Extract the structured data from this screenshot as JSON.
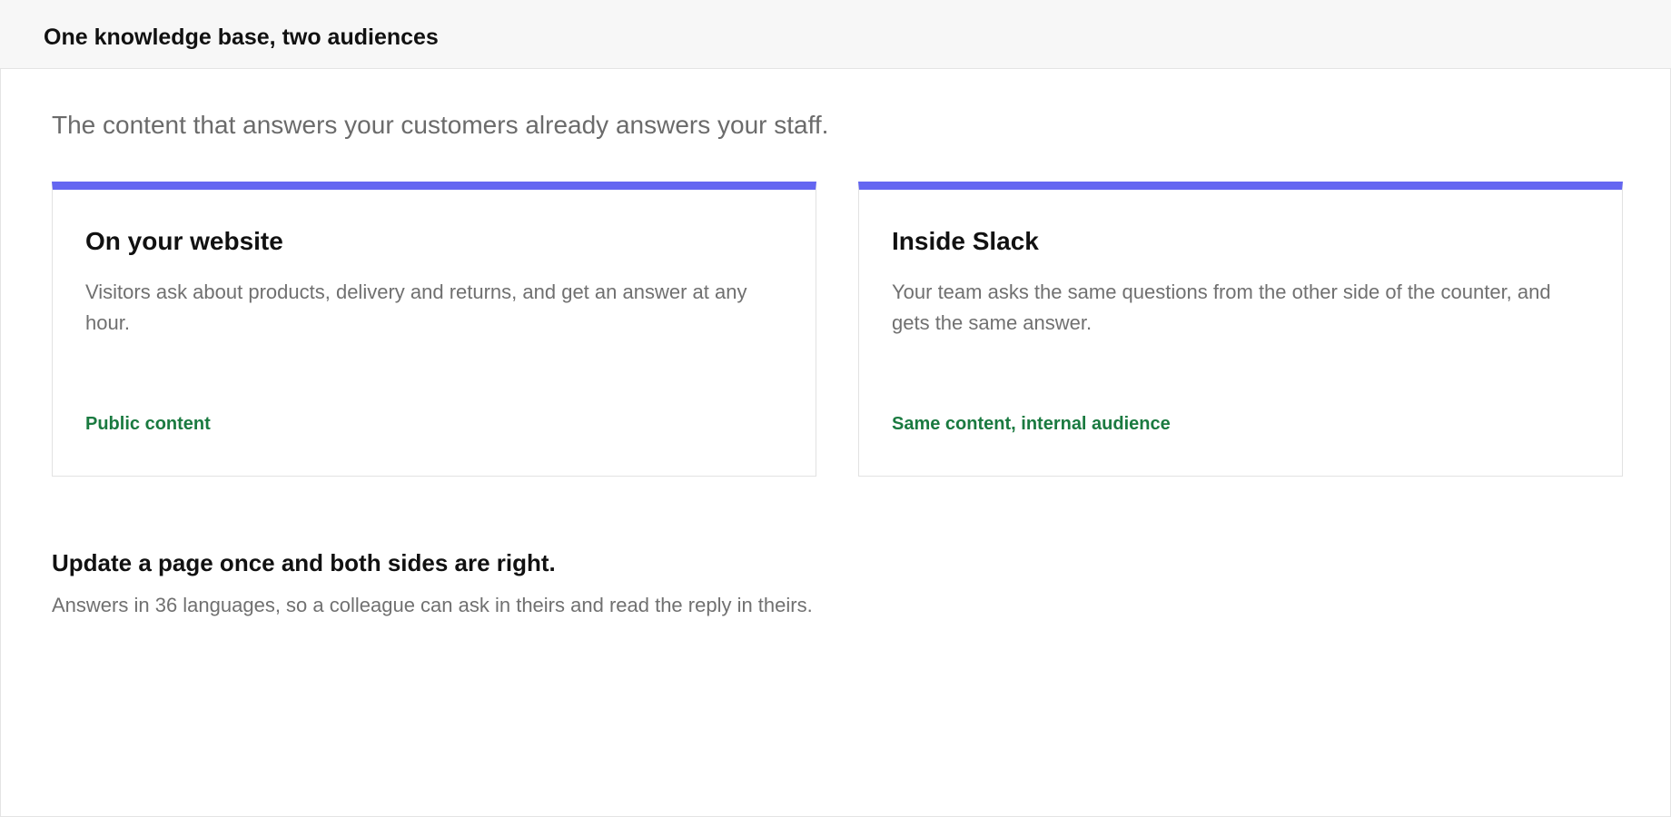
{
  "header": {
    "title": "One knowledge base, two audiences"
  },
  "main": {
    "subtitle": "The content that answers your customers already answers your staff.",
    "cards": [
      {
        "title": "On your website",
        "text": "Visitors ask about products, delivery and returns, and get an answer at any hour.",
        "tag": "Public content"
      },
      {
        "title": "Inside Slack",
        "text": "Your team asks the same questions from the other side of the counter, and gets the same answer.",
        "tag": "Same content, internal audience"
      }
    ],
    "footer": {
      "heading": "Update a page once and both sides are right.",
      "text": "Answers in 36 languages, so a colleague can ask in theirs and read the reply in theirs."
    }
  },
  "colors": {
    "accent": "#6466f1",
    "tag_green": "#1a7a40",
    "header_bg": "#f7f7f7"
  }
}
